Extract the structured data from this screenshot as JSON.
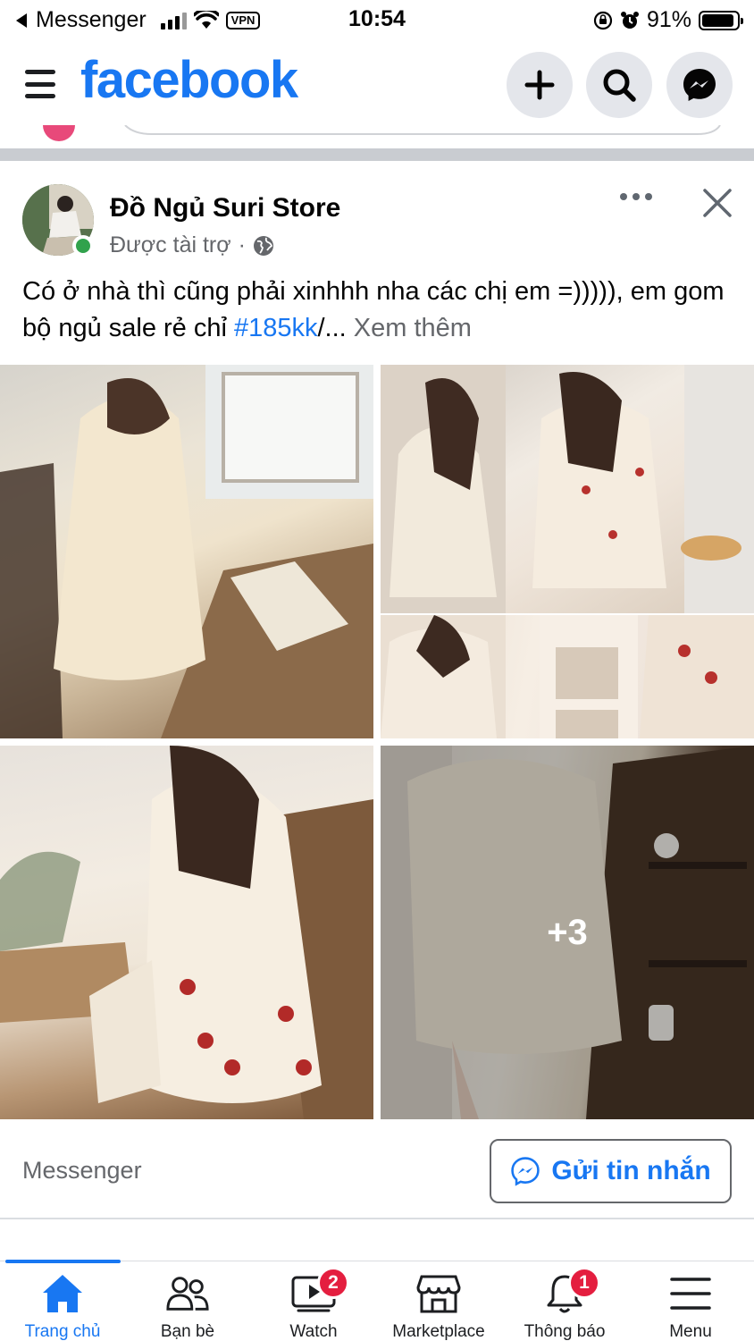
{
  "status_bar": {
    "back_app": "Messenger",
    "vpn": "VPN",
    "time": "10:54",
    "battery": "91%",
    "battery_level": 0.91
  },
  "header": {
    "logo": "facebook",
    "icons": [
      "menu-icon",
      "plus-icon",
      "search-icon",
      "messenger-icon"
    ]
  },
  "post": {
    "page_name": "Đồ Ngủ Suri Store",
    "sponsored": "Được tài trợ",
    "separator": "·",
    "caption_text": "Có ở nhà thì cũng phải xinhhh nha các chị em =))))), em gom bộ ngủ sale rẻ chỉ ",
    "caption_hashtag": "#185kk",
    "caption_suffix": "/... ",
    "see_more": "Xem thêm",
    "photos": [
      {
        "alt": "pajama-photo-1"
      },
      {
        "alt": "pajama-photo-2"
      },
      {
        "alt": "pajama-photo-3"
      },
      {
        "alt": "pajama-photo-4"
      },
      {
        "alt": "pajama-photo-5"
      }
    ],
    "more_photos": "+3",
    "cta_label": "Messenger",
    "cta_button": "Gửi tin nhắn"
  },
  "bottom_nav": {
    "items": [
      {
        "label": "Trang chủ",
        "icon": "home-icon",
        "active": true
      },
      {
        "label": "Bạn bè",
        "icon": "friends-icon"
      },
      {
        "label": "Watch",
        "icon": "watch-icon",
        "badge": "2"
      },
      {
        "label": "Marketplace",
        "icon": "marketplace-icon"
      },
      {
        "label": "Thông báo",
        "icon": "bell-icon",
        "badge": "1"
      },
      {
        "label": "Menu",
        "icon": "menu-icon"
      }
    ]
  },
  "colors": {
    "brand_blue": "#1877f2",
    "badge_red": "#e41e3f",
    "online_green": "#31a24c",
    "secondary_text": "#65676b"
  }
}
